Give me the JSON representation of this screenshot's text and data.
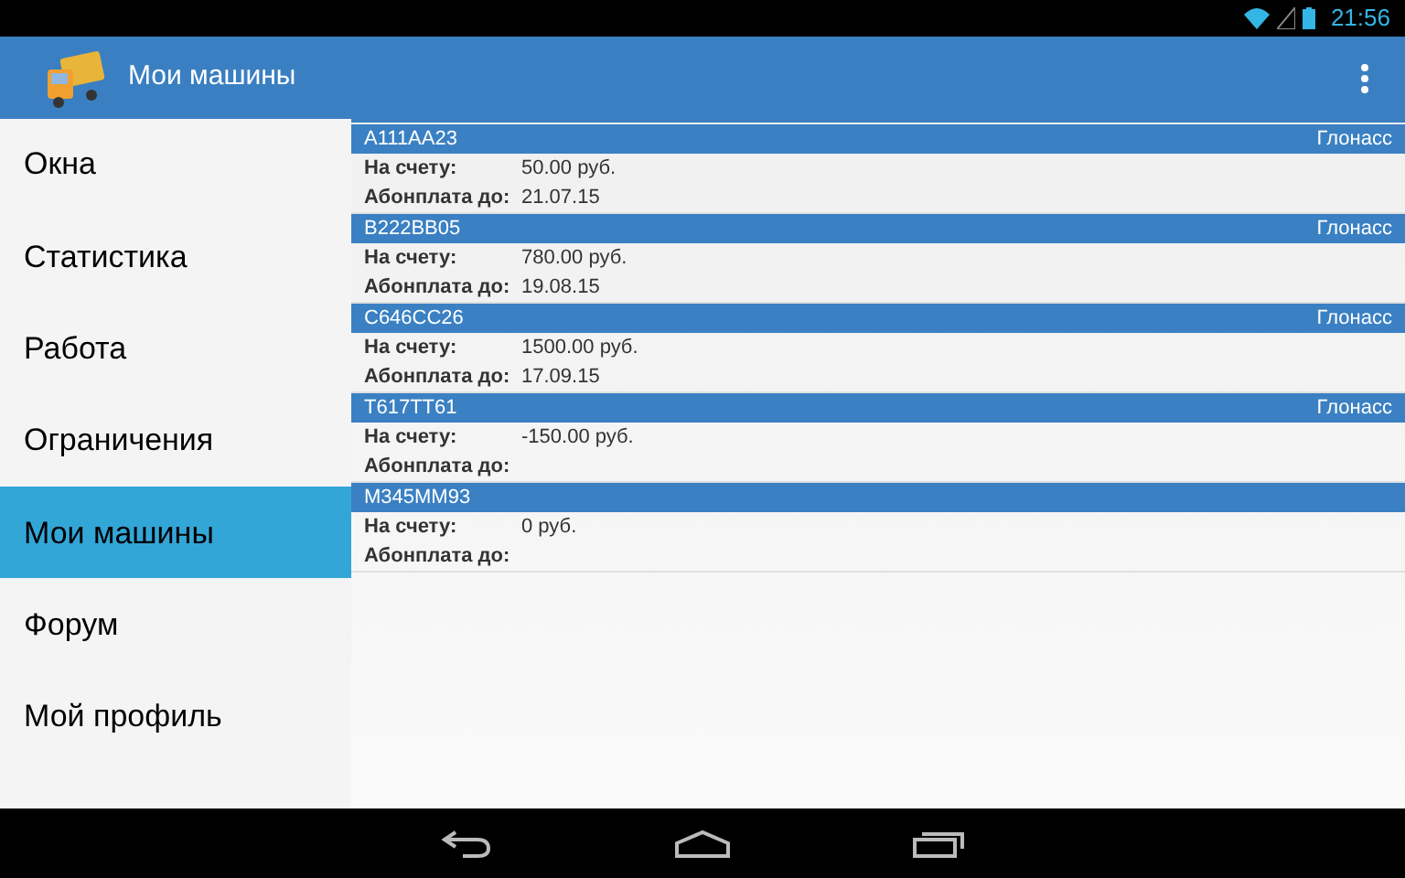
{
  "status_bar": {
    "time": "21:56"
  },
  "app_bar": {
    "title": "Мои машины"
  },
  "sidebar": {
    "items": [
      {
        "label": "Окна",
        "selected": false
      },
      {
        "label": "Статистика",
        "selected": false
      },
      {
        "label": "Работа",
        "selected": false
      },
      {
        "label": "Ограничения",
        "selected": false
      },
      {
        "label": "Мои машины",
        "selected": true
      },
      {
        "label": "Форум",
        "selected": false
      },
      {
        "label": "Мой профиль",
        "selected": false
      }
    ]
  },
  "cars": [
    {
      "plate": "A111AA23",
      "system": "Глонасс",
      "balance_label": "На счету:",
      "balance": "50.00 руб.",
      "paid_label": "Абонплата до:",
      "paid_until": "21.07.15"
    },
    {
      "plate": "B222BB05",
      "system": "Глонасс",
      "balance_label": "На счету:",
      "balance": "780.00 руб.",
      "paid_label": "Абонплата до:",
      "paid_until": "19.08.15"
    },
    {
      "plate": "C646CC26",
      "system": "Глонасс",
      "balance_label": "На счету:",
      "balance": "1500.00 руб.",
      "paid_label": "Абонплата до:",
      "paid_until": "17.09.15"
    },
    {
      "plate": "T617TT61",
      "system": "Глонасс",
      "balance_label": "На счету:",
      "balance": "-150.00 руб.",
      "paid_label": "Абонплата до:"
    },
    {
      "plate": "M345MM93",
      "balance_label": "На счету:",
      "balance": "0 руб.",
      "paid_label": "Абонплата до:"
    }
  ]
}
